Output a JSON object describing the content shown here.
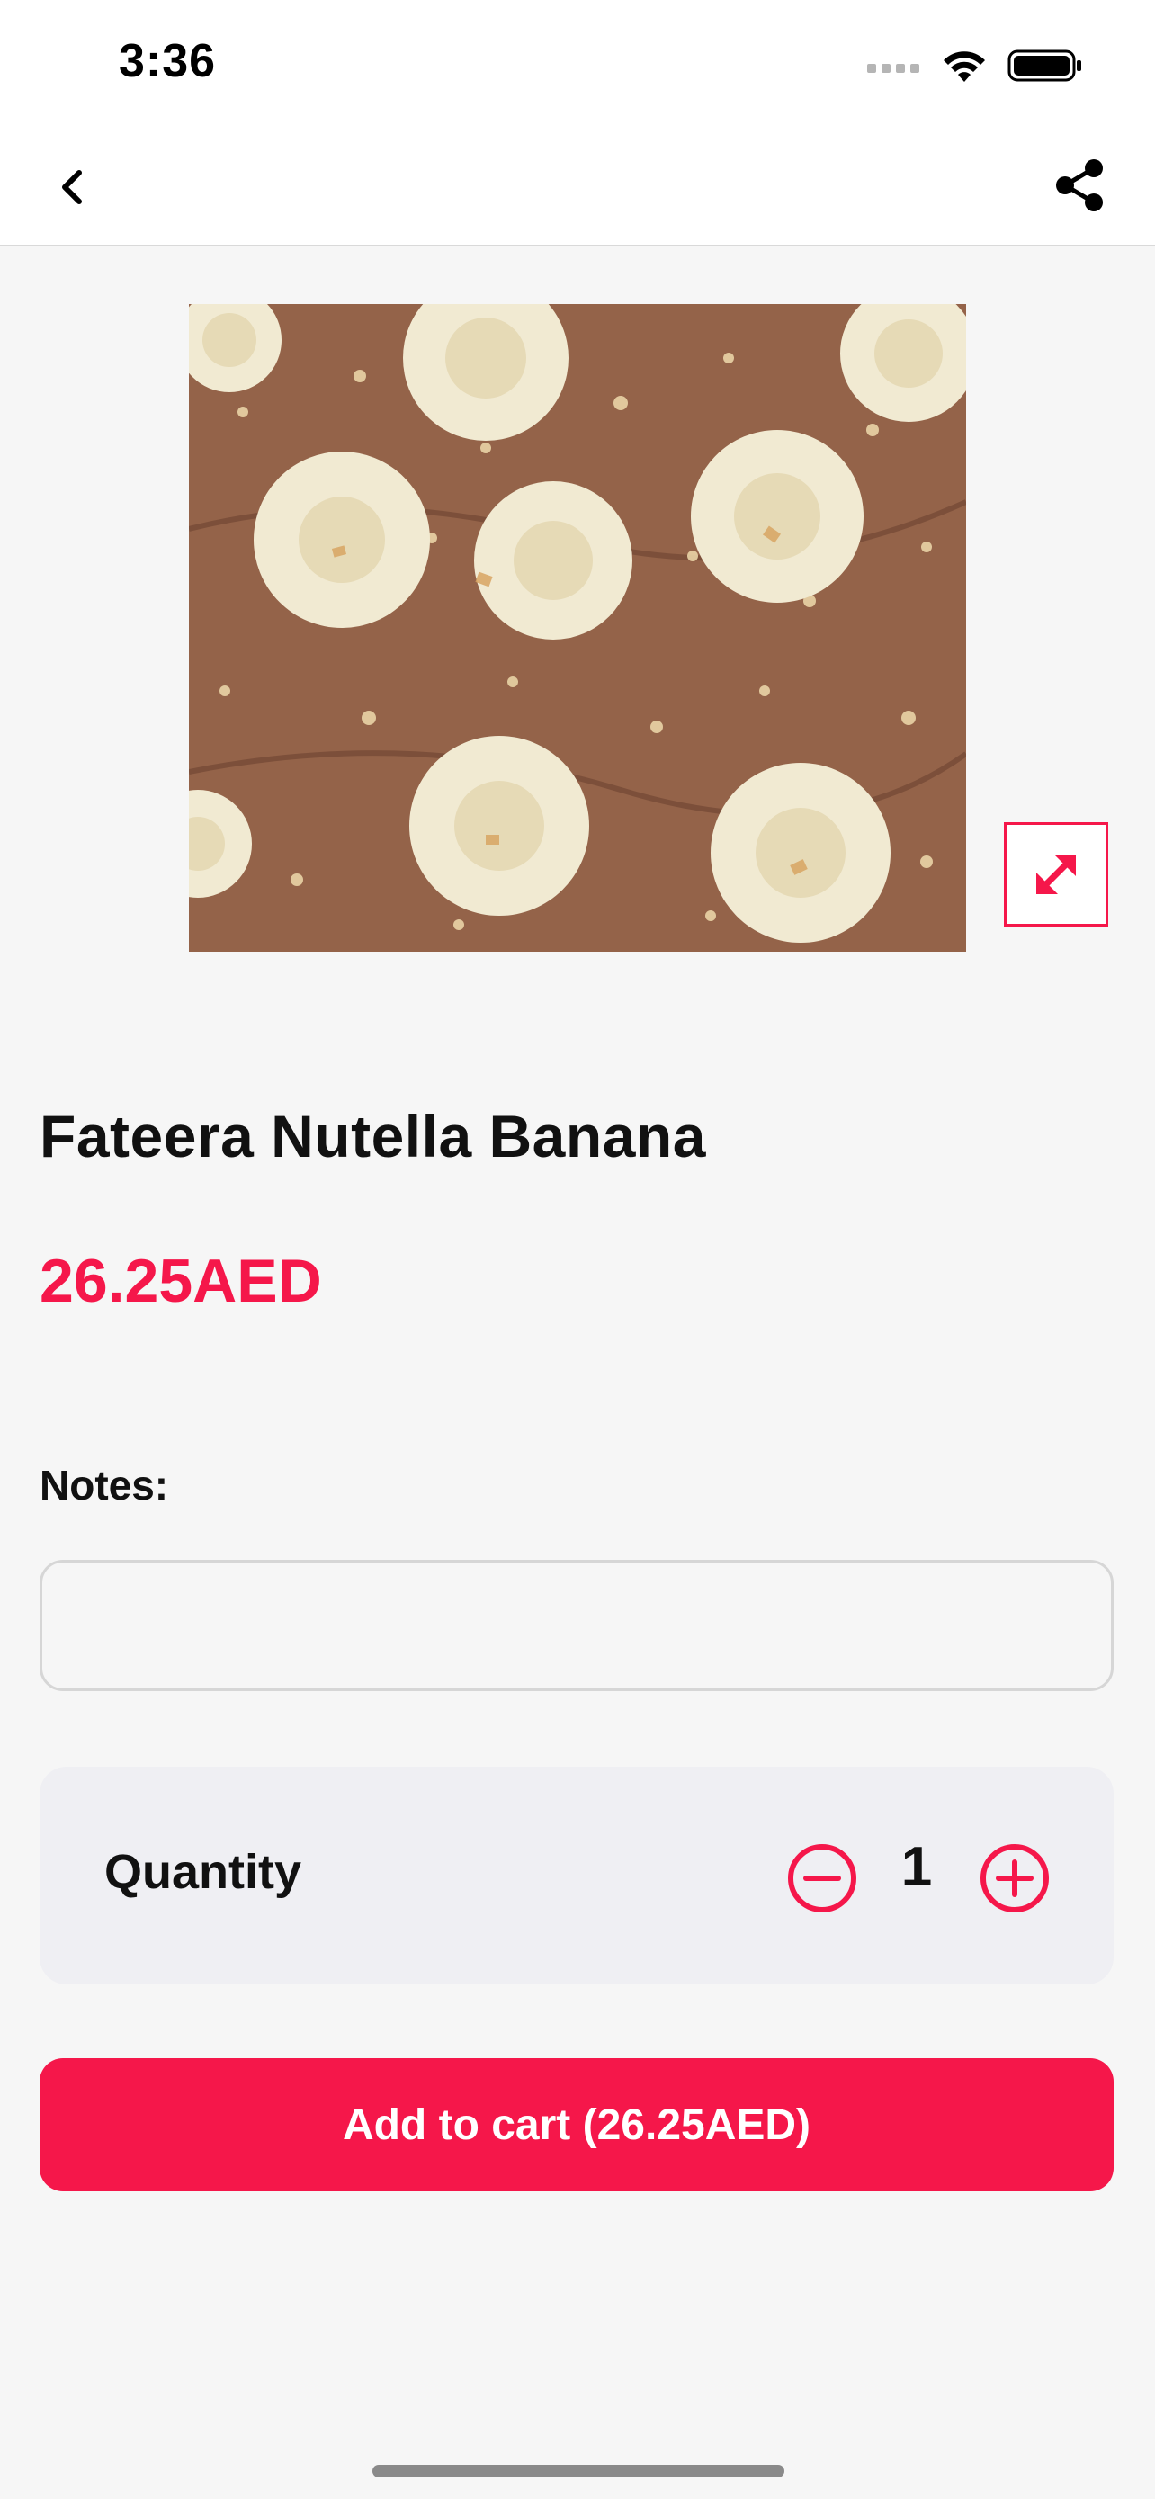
{
  "status_bar": {
    "time": "3:36",
    "icons": [
      "signal-icon",
      "wifi-icon",
      "battery-icon"
    ]
  },
  "nav": {
    "back_icon": "chevron-left-icon",
    "share_icon": "share-icon"
  },
  "product": {
    "image_alt": "Fateera Nutella Banana",
    "title": "Fateera Nutella Banana",
    "price": "26.25AED"
  },
  "notes": {
    "label": "Notes:",
    "value": "",
    "placeholder": ""
  },
  "quantity": {
    "label": "Quantity",
    "value": "1"
  },
  "cart_button": {
    "label": "Add to cart (26.25AED)"
  },
  "colors": {
    "accent": "#f5174a",
    "background": "#f6f6f6",
    "card": "#efeff3"
  }
}
